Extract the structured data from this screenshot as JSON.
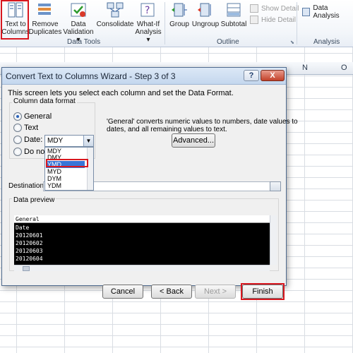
{
  "ribbon": {
    "text_to_columns": [
      "Text to",
      "Columns"
    ],
    "remove_duplicates": [
      "Remove",
      "Duplicates"
    ],
    "data_validation": [
      "Data",
      "Validation ▾"
    ],
    "consolidate": "Consolidate",
    "what_if": [
      "What-If",
      "Analysis ▾"
    ],
    "group": "Group",
    "ungroup": "Ungroup",
    "subtotal": "Subtotal",
    "show_detail": "Show Detail",
    "hide_detail": "Hide Detail",
    "data_analysis": "Data Analysis",
    "groups": {
      "data_tools": "Data Tools",
      "outline": "Outline",
      "analysis": "Analysis"
    }
  },
  "sheet": {
    "col_n": "N",
    "col_o": "O"
  },
  "dialog": {
    "title": "Convert Text to Columns Wizard - Step 3 of 3",
    "help": "?",
    "close": "X",
    "intro": "This screen lets you select each column and set the Data Format.",
    "format_group": "Column data format",
    "opt_general": "General",
    "opt_text": "Text",
    "opt_date": "Date:",
    "opt_skip": "Do not i",
    "general_note": [
      "'General' converts numeric values to numbers, date values to",
      "dates, and all remaining values to text."
    ],
    "advanced": "Advanced...",
    "date_value": "MDY",
    "date_options": [
      "MDY",
      "DMY",
      "YMD",
      "MYD",
      "DYM",
      "YDM"
    ],
    "selected_option": "YMD",
    "destination_label": "Destination:",
    "preview_label": "Data preview",
    "preview_header": "General",
    "preview_rows": [
      "Date",
      "20120601",
      "20120602",
      "20120603",
      "20120604"
    ],
    "buttons": {
      "cancel": "Cancel",
      "back": "< Back",
      "next": "Next >",
      "finish": "Finish"
    }
  },
  "colors": {
    "highlight": "#d8171f",
    "selection": "#3875d7",
    "title_bar": "#c4d7ee"
  }
}
